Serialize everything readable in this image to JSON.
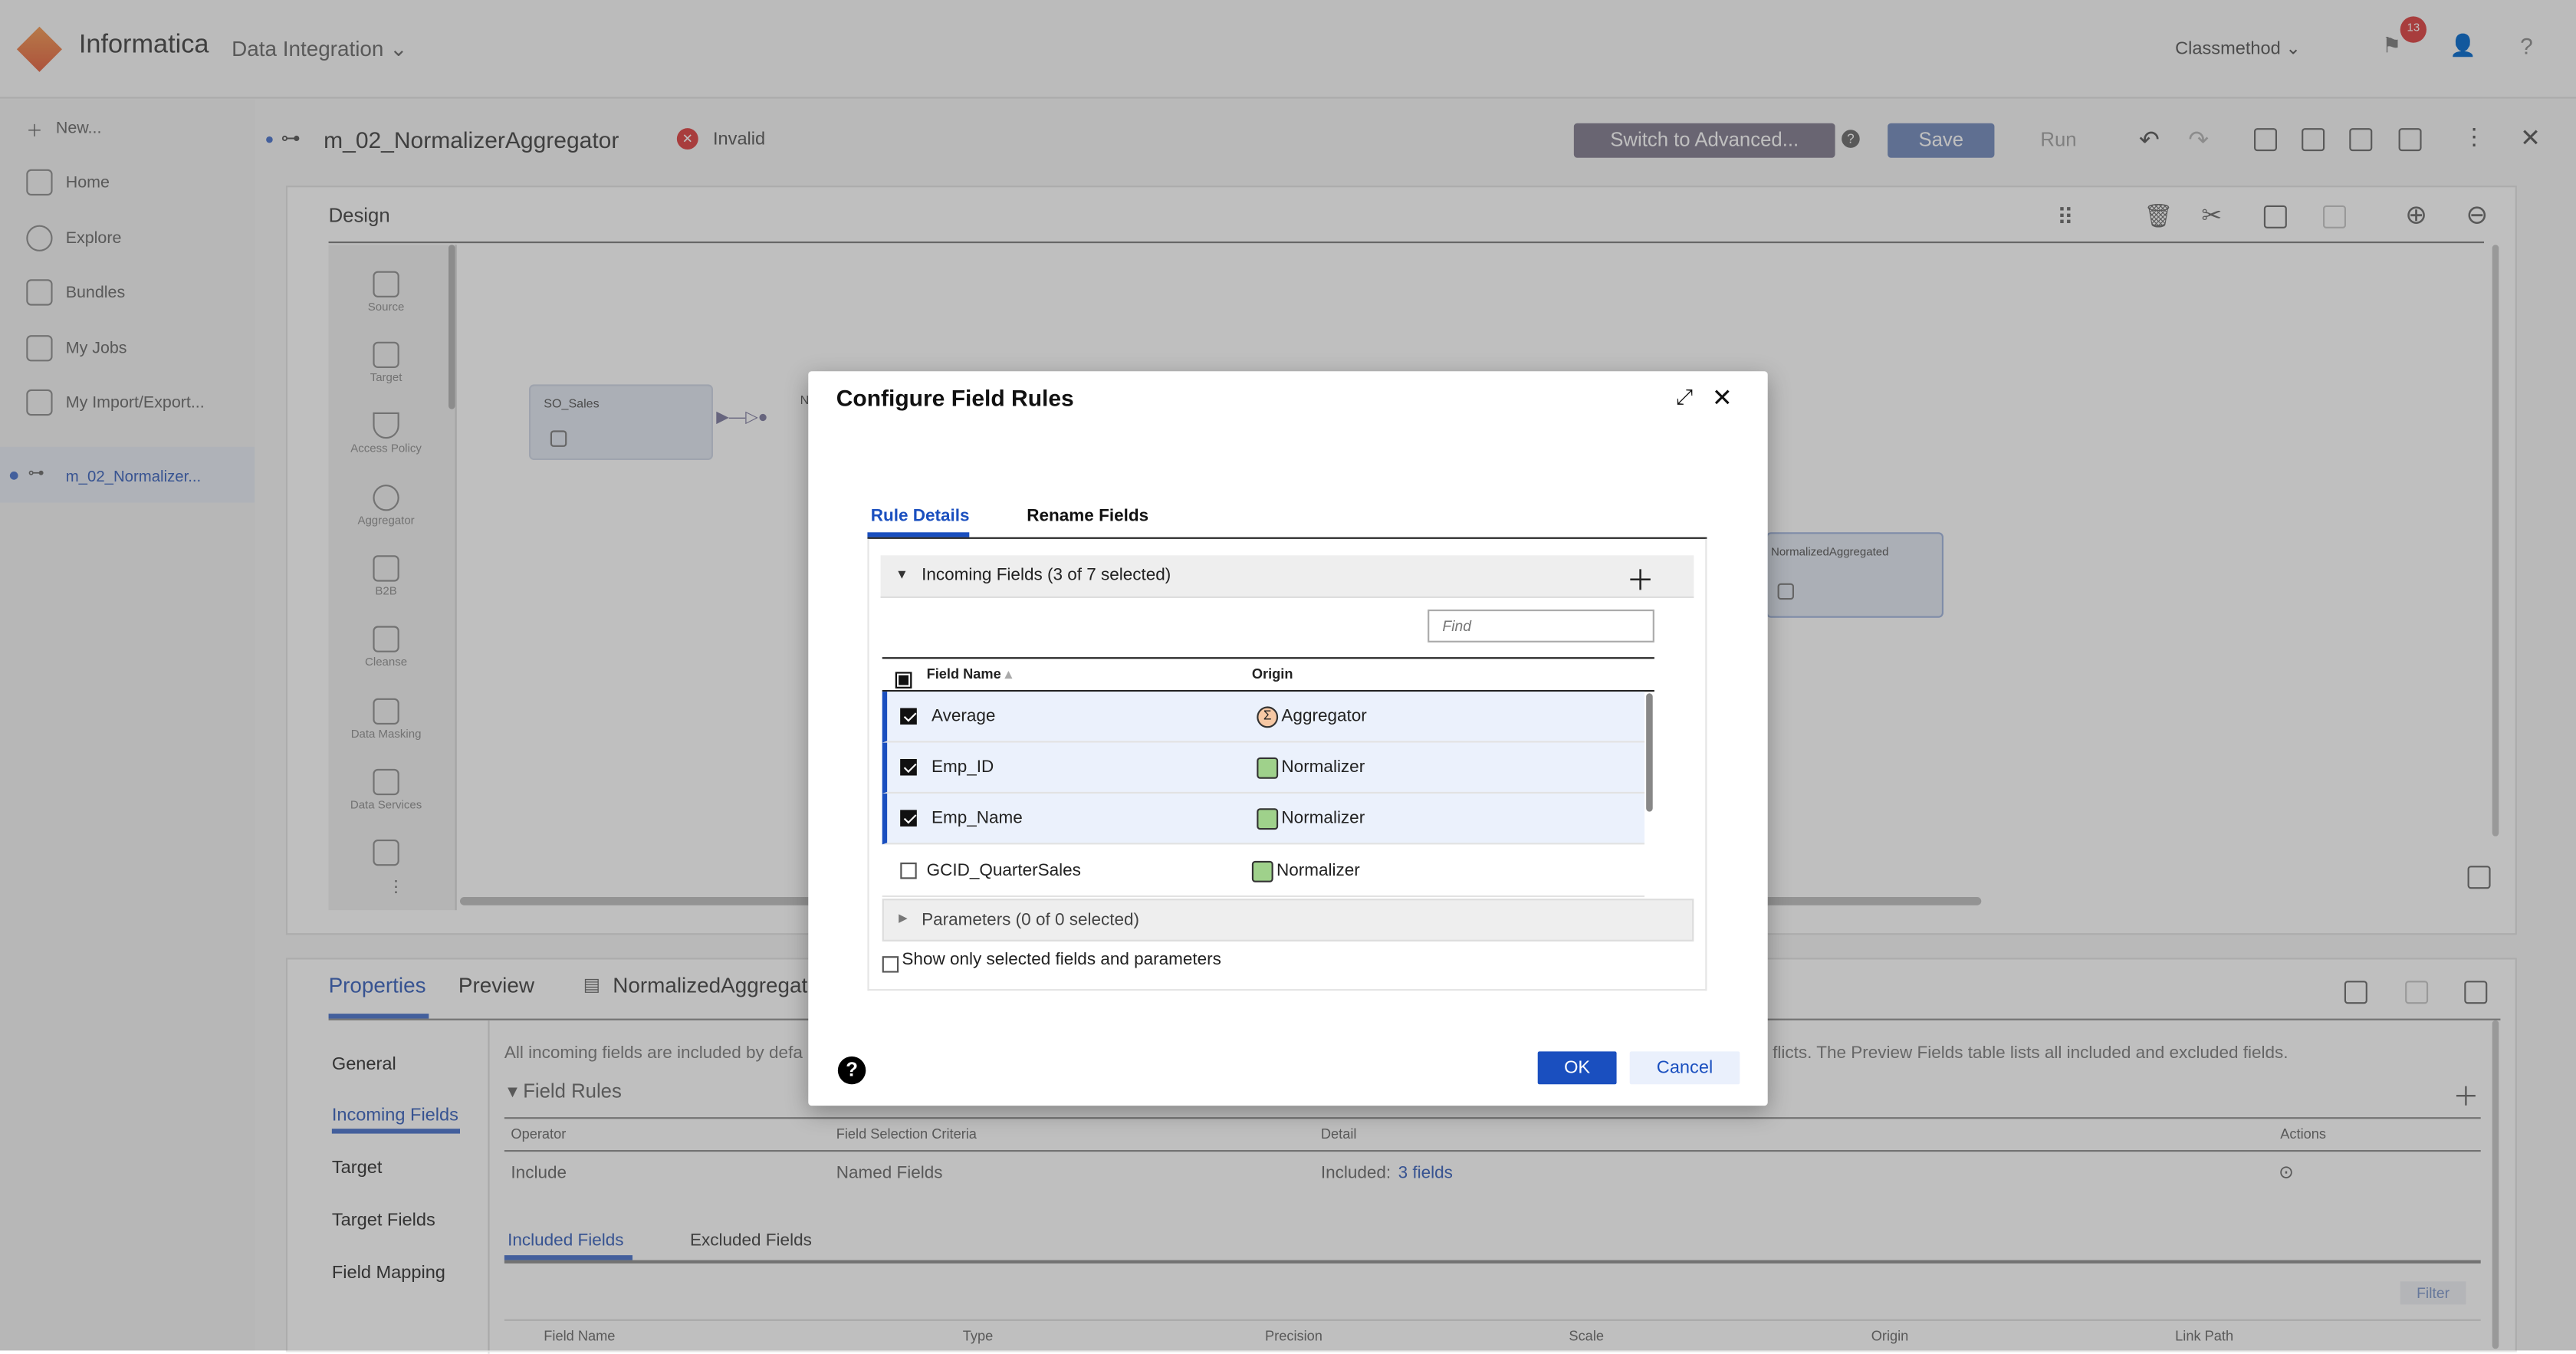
{
  "header": {
    "brand": "Informatica",
    "product": "Data Integration",
    "org": "Classmethod",
    "notification_count": "13",
    "help": "?"
  },
  "sidebar": {
    "items": [
      {
        "label": "New..."
      },
      {
        "label": "Home"
      },
      {
        "label": "Explore"
      },
      {
        "label": "Bundles"
      },
      {
        "label": "My Jobs"
      },
      {
        "label": "My Import/Export..."
      }
    ],
    "open_tab": "m_02_Normalizer..."
  },
  "mapping": {
    "name": "m_02_NormalizerAggregator",
    "status": "Invalid",
    "switch_label": "Switch to Advanced...",
    "save_label": "Save",
    "run_label": "Run"
  },
  "design": {
    "title": "Design",
    "palette": [
      "Source",
      "Target",
      "Access Policy",
      "Aggregator",
      "B2B",
      "Cleanse",
      "Data Masking",
      "Data Services"
    ],
    "nodes": {
      "source": "SO_Sales",
      "target": "NormalizedAggregated",
      "partial": "N"
    }
  },
  "properties": {
    "tabs": [
      "Properties",
      "Preview",
      "NormalizedAggregate"
    ],
    "nav": [
      "General",
      "Incoming Fields",
      "Target",
      "Target Fields",
      "Field Mapping"
    ],
    "description_left": "All incoming fields are included by defa",
    "description_right": "flicts. The Preview Fields table lists all included and excluded fields.",
    "field_rules_label": "Field Rules",
    "rules_columns": [
      "Operator",
      "Field Selection Criteria",
      "Detail",
      "Actions"
    ],
    "rule": {
      "operator": "Include",
      "criteria": "Named Fields",
      "detail_prefix": "Included:",
      "detail_link": "3 fields"
    },
    "subtabs": [
      "Included Fields",
      "Excluded Fields"
    ],
    "filter_label": "Filter",
    "fields_columns": [
      "Field Name",
      "Type",
      "Precision",
      "Scale",
      "Origin",
      "Link Path"
    ]
  },
  "dialog": {
    "title": "Configure Field Rules",
    "tabs": [
      "Rule Details",
      "Rename Fields"
    ],
    "incoming_header": "Incoming Fields (3 of 7 selected)",
    "find_placeholder": "Find",
    "columns": [
      "Field Name",
      "Origin"
    ],
    "rows": [
      {
        "name": "Average",
        "origin": "Aggregator",
        "checked": true
      },
      {
        "name": "Emp_ID",
        "origin": "Normalizer",
        "checked": true
      },
      {
        "name": "Emp_Name",
        "origin": "Normalizer",
        "checked": true
      },
      {
        "name": "GCID_QuarterSales",
        "origin": "Normalizer",
        "checked": false
      }
    ],
    "parameters_header": "Parameters (0 of 0 selected)",
    "show_selected_label": "Show only selected fields and parameters",
    "ok_label": "OK",
    "cancel_label": "Cancel"
  },
  "colors": {
    "accent": "#1a4fbf",
    "selected_row": "#ebf1fc",
    "invalid": "#e05252"
  }
}
